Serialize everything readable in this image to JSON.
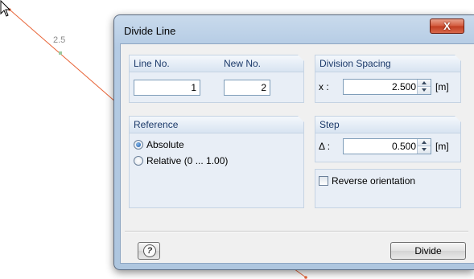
{
  "canvas": {
    "point_label": "2.5"
  },
  "dialog": {
    "title": "Divide Line",
    "close_label": "X",
    "line_group": {
      "line_no_label": "Line No.",
      "line_no_value": "1",
      "new_no_label": "New No.",
      "new_no_value": "2"
    },
    "spacing_group": {
      "header": "Division Spacing",
      "x_label": "x :",
      "value": "2.500",
      "unit": "[m]"
    },
    "reference_group": {
      "header": "Reference",
      "options": [
        {
          "label": "Absolute",
          "selected": true
        },
        {
          "label": "Relative (0 ... 1.00)",
          "selected": false
        }
      ]
    },
    "step_group": {
      "header": "Step",
      "delta_label": "Δ :",
      "value": "0.500",
      "unit": "[m]"
    },
    "reverse_orientation": {
      "label": "Reverse orientation",
      "checked": false
    },
    "buttons": {
      "help_icon": "help-icon",
      "divide_label": "Divide"
    }
  },
  "colors": {
    "line": "#e8663a",
    "point": "#9fc89f",
    "group_header_text": "#1c3a6a",
    "close_button": "#c8472a"
  }
}
